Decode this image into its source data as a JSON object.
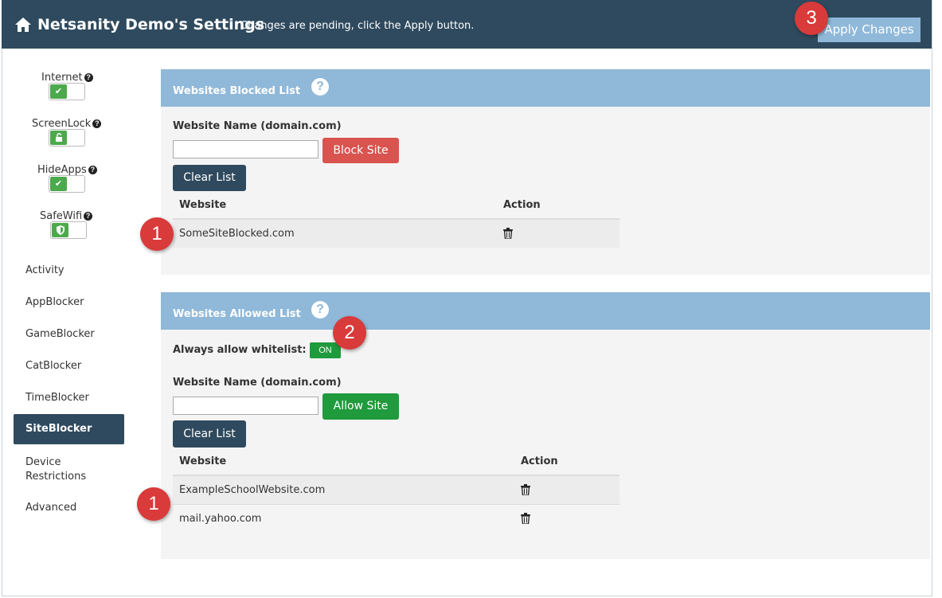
{
  "header": {
    "title": "Netsanity Demo's Settings",
    "pending_message": "Changes are pending, click the Apply button.",
    "apply_label": "Apply Changes"
  },
  "toggles": [
    {
      "label": "Internet",
      "state_icon": "check-icon",
      "help": "?"
    },
    {
      "label": "ScreenLock",
      "state_icon": "unlock-icon",
      "help": "?"
    },
    {
      "label": "HideApps",
      "state_icon": "check-icon",
      "help": "?"
    },
    {
      "label": "SafeWifi",
      "state_icon": "shield-icon",
      "help": "?"
    }
  ],
  "nav": {
    "items": [
      "Activity",
      "AppBlocker",
      "GameBlocker",
      "CatBlocker",
      "TimeBlocker",
      "SiteBlocker",
      "Device Restrictions",
      "Advanced"
    ],
    "device_line1": "Device",
    "device_line2": "Restrictions",
    "active": "SiteBlocker"
  },
  "blocked": {
    "title": "Websites Blocked List",
    "field_label": "Website Name (domain.com)",
    "input_value": "",
    "block_label": "Block Site",
    "clear_label": "Clear List",
    "col_website": "Website",
    "col_action": "Action",
    "rows": [
      "SomeSiteBlocked.com"
    ]
  },
  "allowed": {
    "title": "Websites Allowed List",
    "always_label": "Always allow whitelist:",
    "always_state": "ON",
    "field_label": "Website Name (domain.com)",
    "input_value": "",
    "allow_label": "Allow Site",
    "clear_label": "Clear List",
    "col_website": "Website",
    "col_action": "Action",
    "rows": [
      "ExampleSchoolWebsite.com",
      "mail.yahoo.com"
    ]
  },
  "badges": [
    "1",
    "1",
    "2",
    "3"
  ],
  "colors": {
    "header_bg": "#2f4a5e",
    "panel_head": "#8fb8d9",
    "danger": "#d9534f",
    "success": "#1f9a3c",
    "badge": "#d93a3a"
  }
}
